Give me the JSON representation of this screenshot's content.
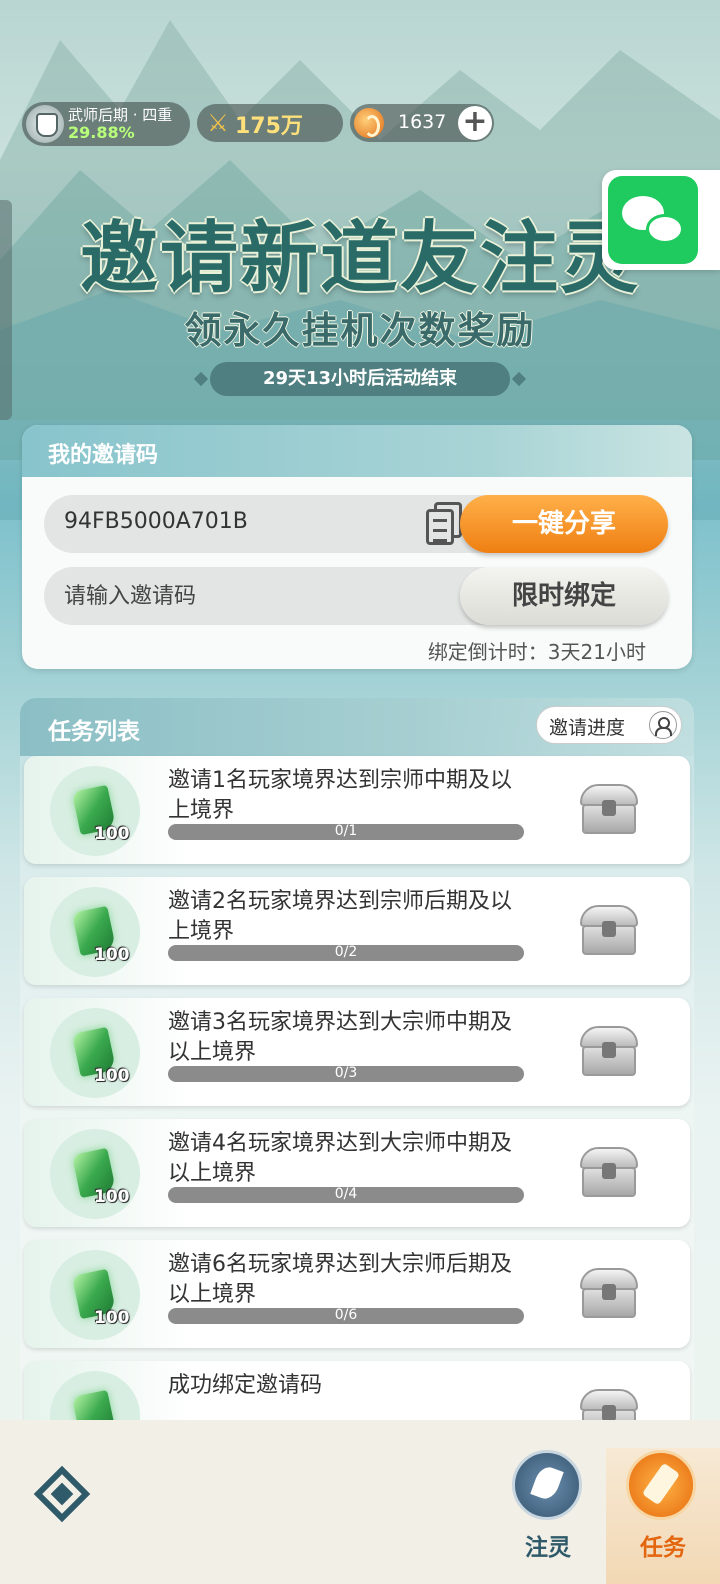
{
  "status": {
    "rank_title": "武师后期 · 四重",
    "rank_progress": "29.88%",
    "power": "175万",
    "currency": "1637",
    "plus_label": "+"
  },
  "banner": {
    "title": "邀请新道友注灵",
    "subtitle": "领永久挂机次数奖励",
    "timer": "29天13小时后活动结束"
  },
  "invite_card": {
    "header": "我的邀请码",
    "code": "94FB5000A701B",
    "share_label": "一键分享",
    "input_placeholder": "请输入邀请码",
    "bind_label": "限时绑定",
    "countdown": "绑定倒计时：3天21小时"
  },
  "tasks": {
    "header": "任务列表",
    "progress_button": "邀请进度",
    "items": [
      {
        "desc": "邀请1名玩家境界达到宗师中期及以上境界",
        "reward": "100",
        "progress": "0/1",
        "fraction": 0
      },
      {
        "desc": "邀请2名玩家境界达到宗师后期及以上境界",
        "reward": "100",
        "progress": "0/2",
        "fraction": 0
      },
      {
        "desc": "邀请3名玩家境界达到大宗师中期及以上境界",
        "reward": "100",
        "progress": "0/3",
        "fraction": 0
      },
      {
        "desc": "邀请4名玩家境界达到大宗师中期及以上境界",
        "reward": "100",
        "progress": "0/4",
        "fraction": 0
      },
      {
        "desc": "邀请6名玩家境界达到大宗师后期及以上境界",
        "reward": "100",
        "progress": "0/6",
        "fraction": 0
      },
      {
        "desc": "成功绑定邀请码",
        "reward": "",
        "progress": "",
        "fraction": 0
      }
    ]
  },
  "bottom_nav": {
    "tab1": "注灵",
    "tab2": "任务",
    "active": "任务"
  },
  "colors": {
    "accent_orange": "#ef7f12",
    "wechat_green": "#1fcb5e",
    "teal": "#2a6b68"
  },
  "icons": [
    "avatar-icon",
    "sword-icon",
    "coin-icon",
    "plus-icon",
    "wechat-icon",
    "copy-icon",
    "add-user-icon",
    "jade-gem-icon",
    "treasure-chest-icon",
    "logo-icon",
    "leaf-icon",
    "scroll-icon"
  ]
}
